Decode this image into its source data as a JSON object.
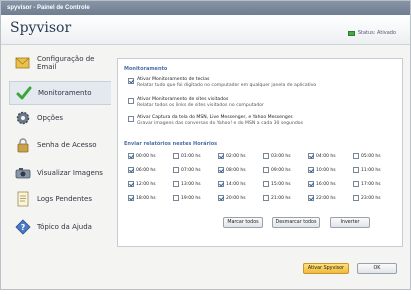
{
  "window": {
    "title": "spyvisor - Painel de Controle"
  },
  "header": {
    "app_title": "Spyvisor",
    "status_label": "Status: Ativado"
  },
  "sidebar": {
    "items": [
      {
        "label": "Configuração de Email",
        "icon": "envelope-icon"
      },
      {
        "label": "Monitoramento",
        "icon": "checkmark-icon"
      },
      {
        "label": "Opções",
        "icon": "gear-icon"
      },
      {
        "label": "Senha de Acesso",
        "icon": "lock-icon"
      },
      {
        "label": "Visualizar Imagens",
        "icon": "camera-icon"
      },
      {
        "label": "Logs Pendentes",
        "icon": "document-icon"
      },
      {
        "label": "Tópico da Ajuda",
        "icon": "help-icon"
      }
    ]
  },
  "monitoring": {
    "title": "Monitoramento",
    "options": [
      {
        "checked": true,
        "label": "Ativar Monitoramento de teclas",
        "desc": "Relatar tudo que foi digitado no computador em qualquer janela de aplicativo"
      },
      {
        "checked": false,
        "label": "Ativar Monitoramento de sites visitados",
        "desc": "Relatar todos os links de sites visitados no computador"
      },
      {
        "checked": false,
        "label": "Ativar Captura da tela do MSN, Live Messenger, e Yahoo Messenger.",
        "desc": "Gravar imagens das conversas do Yahoo! e do MSN a cada 30 segundos"
      }
    ]
  },
  "reports": {
    "title": "Enviar relatórios nestes Horários",
    "hours": [
      {
        "label": "00:00 hs",
        "checked": true
      },
      {
        "label": "01:00 hs",
        "checked": false
      },
      {
        "label": "02:00 hs",
        "checked": true
      },
      {
        "label": "03:00 hs",
        "checked": false
      },
      {
        "label": "04:00 hs",
        "checked": true
      },
      {
        "label": "05:00 hs",
        "checked": false
      },
      {
        "label": "06:00 hs",
        "checked": true
      },
      {
        "label": "07:00 hs",
        "checked": false
      },
      {
        "label": "08:00 hs",
        "checked": true
      },
      {
        "label": "09:00 hs",
        "checked": false
      },
      {
        "label": "10:00 hs",
        "checked": true
      },
      {
        "label": "11:00 hs",
        "checked": false
      },
      {
        "label": "12:00 hs",
        "checked": true
      },
      {
        "label": "13:00 hs",
        "checked": false
      },
      {
        "label": "14:00 hs",
        "checked": true
      },
      {
        "label": "15:00 hs",
        "checked": false
      },
      {
        "label": "16:00 hs",
        "checked": true
      },
      {
        "label": "17:00 hs",
        "checked": false
      },
      {
        "label": "18:00 hs",
        "checked": true
      },
      {
        "label": "19:00 hs",
        "checked": false
      },
      {
        "label": "20:00 hs",
        "checked": true
      },
      {
        "label": "21:00 hs",
        "checked": false
      },
      {
        "label": "22:00 hs",
        "checked": true
      },
      {
        "label": "23:00 hs",
        "checked": false
      }
    ],
    "buttons": {
      "mark_all": "Marcar todos",
      "unmark_all": "Desmarcar todos",
      "invert": "Inverter"
    }
  },
  "footer": {
    "activate": "Ativar Spyvisor",
    "ok": "OK"
  }
}
